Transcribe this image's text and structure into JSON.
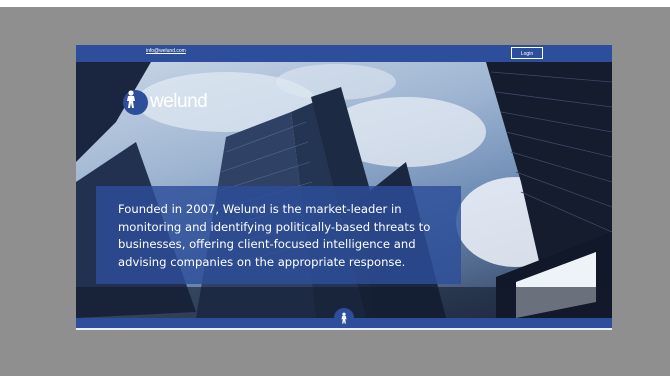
{
  "header": {
    "email": "info@welund.com",
    "login_label": "Login"
  },
  "brand": {
    "name": "welund"
  },
  "hero": {
    "description": "Founded in 2007, Welund is the market-leader in monitoring and identifying politically-based threats to businesses, offering client-focused intelligence and advising companies on the appropriate response."
  },
  "colors": {
    "primary": "#2d4e9a",
    "text": "#ffffff"
  },
  "icons": {
    "logo_mark": "knight-figure-icon",
    "footer_mark": "knight-figure-icon"
  }
}
